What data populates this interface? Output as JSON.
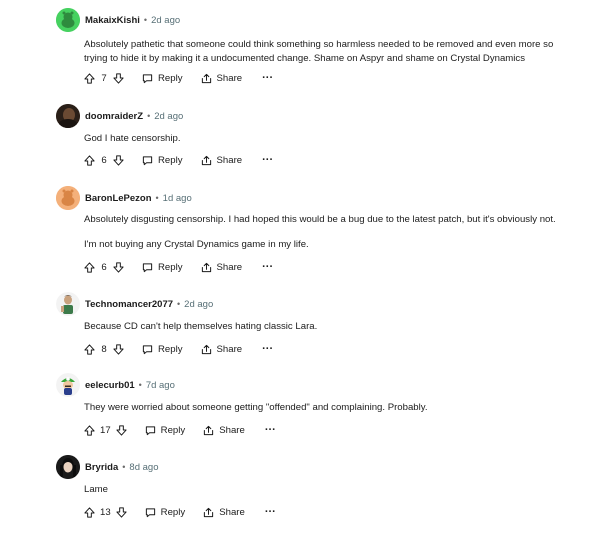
{
  "comments": [
    {
      "username": "MakaixKishi",
      "time": "2d ago",
      "avatar": "green-snoo-avatar",
      "avatar_color": "#46d160",
      "paragraphs": [
        "Absolutely pathetic that someone could think something so harmless needed to be removed and even more so",
        "trying to hide it by making it a undocumented change. Shame on Aspyr and shame on Crystal Dynamics"
      ],
      "score": "7"
    },
    {
      "username": "doomraiderZ",
      "time": "2d ago",
      "avatar": "dark-photo-avatar",
      "avatar_color": "#3b2a1e",
      "paragraphs": [
        "God I hate censorship."
      ],
      "score": "6"
    },
    {
      "username": "BaronLePezon",
      "time": "1d ago",
      "avatar": "orange-snoo-avatar",
      "avatar_color": "#f2a66a",
      "paragraphs": [
        "Absolutely disgusting censorship. I had hoped this would be a bug due to the latest patch, but it's obviously not.",
        "I'm not buying any Crystal Dynamics game in my life."
      ],
      "score": "6"
    },
    {
      "username": "Technomancer2077",
      "time": "2d ago",
      "avatar": "character-avatar",
      "avatar_color": "#c9a27e",
      "paragraphs": [
        "Because CD can't help themselves hating classic Lara."
      ],
      "score": "8"
    },
    {
      "username": "eelecurb01",
      "time": "7d ago",
      "avatar": "luigi-avatar",
      "avatar_color": "#3aa83a",
      "paragraphs": [
        "They were worried about someone getting \"offended\" and complaining. Probably."
      ],
      "score": "17"
    },
    {
      "username": "Bryrida",
      "time": "8d ago",
      "avatar": "dark-hair-avatar",
      "avatar_color": "#222222",
      "paragraphs": [
        "Lame"
      ],
      "score": "13"
    }
  ],
  "labels": {
    "dot": "•",
    "reply": "Reply",
    "share": "Share",
    "more": "···"
  }
}
